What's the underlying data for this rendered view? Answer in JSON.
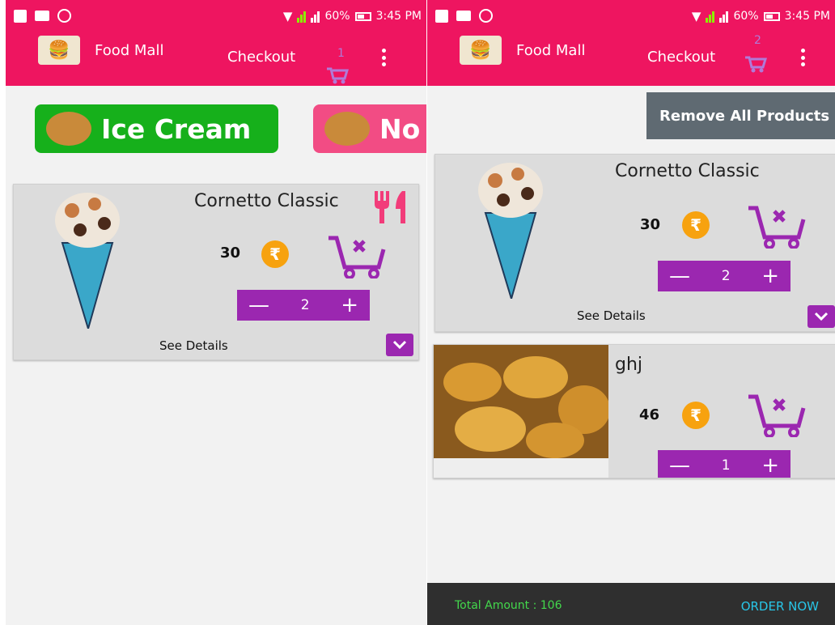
{
  "status_bar": {
    "battery": "60%",
    "time": "3:45 PM"
  },
  "app": {
    "title": "Food Mall",
    "checkout_label": "Checkout",
    "accent_color": "#ee1560",
    "button_purple": "#9b27b0"
  },
  "left_screen": {
    "cart_count": "1",
    "categories": [
      {
        "label": "Ice Cream",
        "color": "#16b01b"
      },
      {
        "label": "No",
        "color": "#f24c84"
      }
    ],
    "product": {
      "name": "Cornetto Classic",
      "price": "30",
      "quantity": "2",
      "details_label": "See Details"
    }
  },
  "right_screen": {
    "cart_count": "2",
    "remove_all_label": "Remove All Products",
    "products": [
      {
        "name": "Cornetto Classic",
        "price": "30",
        "quantity": "2",
        "details_label": "See Details"
      },
      {
        "name": "ghj",
        "price": "46",
        "quantity": "1"
      }
    ],
    "footer": {
      "total_label": "Total Amount : 106",
      "order_label": "ORDER NOW"
    }
  },
  "icons": [
    "facebook-icon",
    "mail-icon",
    "whatsapp-icon",
    "wifi-icon",
    "signal-icon",
    "battery-icon",
    "cart-icon",
    "more-vert-icon",
    "rupee-icon",
    "cart-remove-icon",
    "cutlery-icon",
    "chevron-down-icon"
  ]
}
